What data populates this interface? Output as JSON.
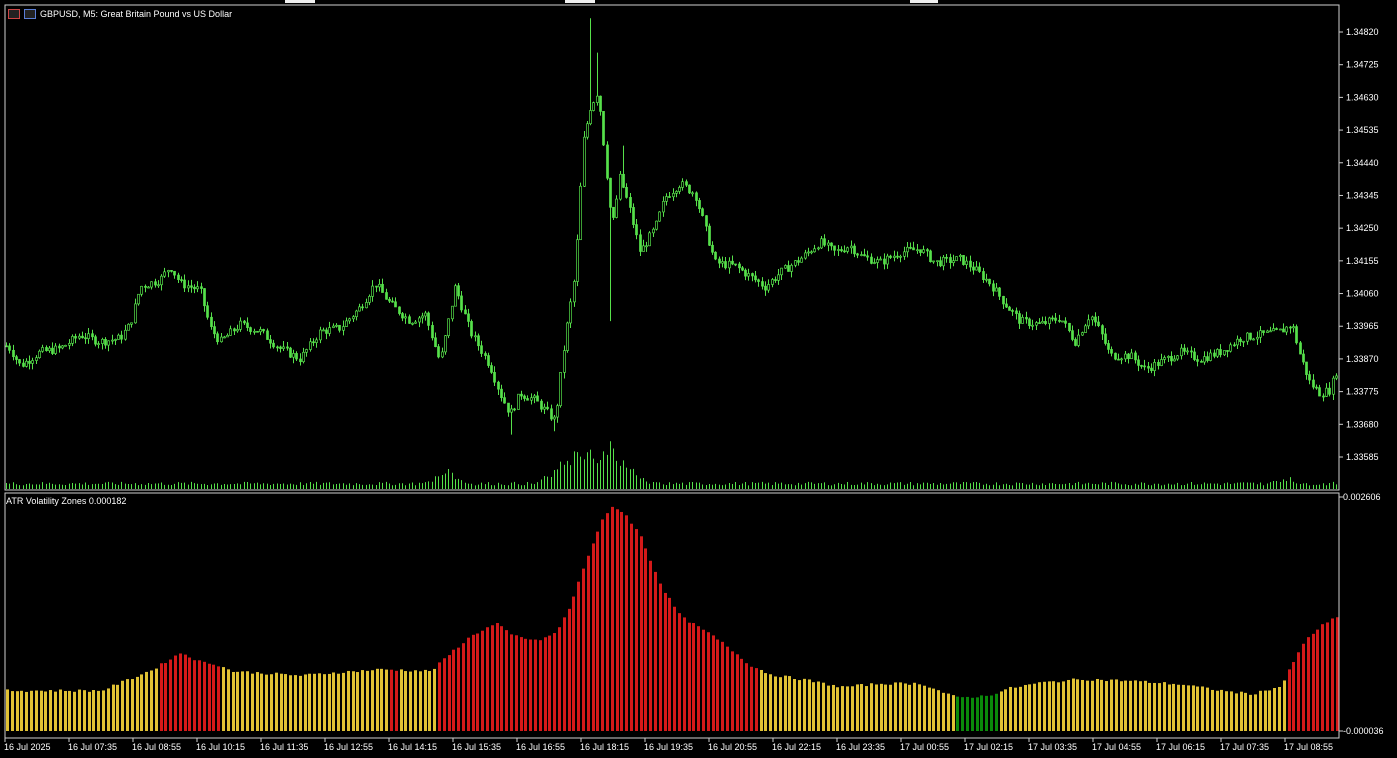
{
  "window": {
    "title": "GBPUSD, M5:  Great Britain Pound vs US Dollar"
  },
  "indicator": {
    "title": "ATR Volatility Zones 0.000182"
  },
  "icons": [
    "chart-window-icon",
    "chart-window-icon-2"
  ],
  "chart_data": [
    {
      "type": "candlestick",
      "title": "GBPUSD, M5:  Great Britain Pound vs US Dollar",
      "color_up": "#56e04a",
      "color_down": "#56e04a",
      "ylim": [
        1.3354,
        1.3489
      ],
      "y_ticks": [
        "1.34820",
        "1.34725",
        "1.34630",
        "1.34535",
        "1.34440",
        "1.34345",
        "1.34250",
        "1.34155",
        "1.34060",
        "1.33965",
        "1.33870",
        "1.33775",
        "1.33680",
        "1.33585"
      ],
      "x_ticks": [
        "16 Jul 2025",
        "16 Jul 07:35",
        "16 Jul 08:55",
        "16 Jul 10:15",
        "16 Jul 11:35",
        "16 Jul 12:55",
        "16 Jul 14:15",
        "16 Jul 15:35",
        "16 Jul 16:55",
        "16 Jul 18:15",
        "16 Jul 19:35",
        "16 Jul 20:55",
        "16 Jul 22:15",
        "16 Jul 23:35",
        "17 Jul 00:55",
        "17 Jul 02:15",
        "17 Jul 03:35",
        "17 Jul 04:55",
        "17 Jul 06:15",
        "17 Jul 07:35",
        "17 Jul 08:55"
      ],
      "close_path": [
        [
          0,
          1.3392
        ],
        [
          10,
          1.339
        ],
        [
          20,
          1.3385
        ],
        [
          40,
          1.3389
        ],
        [
          60,
          1.339
        ],
        [
          80,
          1.3394
        ],
        [
          100,
          1.3392
        ],
        [
          120,
          1.3393
        ],
        [
          130,
          1.3397
        ],
        [
          140,
          1.3408
        ],
        [
          160,
          1.341
        ],
        [
          170,
          1.3414
        ],
        [
          180,
          1.3409
        ],
        [
          200,
          1.3407
        ],
        [
          210,
          1.3396
        ],
        [
          220,
          1.3392
        ],
        [
          240,
          1.3397
        ],
        [
          260,
          1.3395
        ],
        [
          280,
          1.339
        ],
        [
          300,
          1.3387
        ],
        [
          320,
          1.3395
        ],
        [
          340,
          1.3396
        ],
        [
          360,
          1.3402
        ],
        [
          375,
          1.3409
        ],
        [
          390,
          1.3403
        ],
        [
          410,
          1.3398
        ],
        [
          425,
          1.34
        ],
        [
          440,
          1.3386
        ],
        [
          455,
          1.3408
        ],
        [
          470,
          1.3395
        ],
        [
          490,
          1.3385
        ],
        [
          500,
          1.3377
        ],
        [
          510,
          1.3371
        ],
        [
          520,
          1.3377
        ],
        [
          535,
          1.3375
        ],
        [
          545,
          1.3372
        ],
        [
          555,
          1.3369
        ],
        [
          565,
          1.3393
        ],
        [
          575,
          1.3412
        ],
        [
          583,
          1.345
        ],
        [
          590,
          1.346
        ],
        [
          598,
          1.3465
        ],
        [
          604,
          1.3448
        ],
        [
          612,
          1.3425
        ],
        [
          620,
          1.344
        ],
        [
          630,
          1.343
        ],
        [
          640,
          1.3418
        ],
        [
          655,
          1.3425
        ],
        [
          665,
          1.3434
        ],
        [
          680,
          1.3438
        ],
        [
          695,
          1.3435
        ],
        [
          705,
          1.3425
        ],
        [
          715,
          1.3415
        ],
        [
          735,
          1.3414
        ],
        [
          750,
          1.3411
        ],
        [
          765,
          1.3408
        ],
        [
          780,
          1.3412
        ],
        [
          800,
          1.3416
        ],
        [
          820,
          1.3421
        ],
        [
          835,
          1.3418
        ],
        [
          850,
          1.342
        ],
        [
          860,
          1.3417
        ],
        [
          880,
          1.3415
        ],
        [
          900,
          1.3418
        ],
        [
          920,
          1.3419
        ],
        [
          935,
          1.3415
        ],
        [
          960,
          1.3416
        ],
        [
          975,
          1.3413
        ],
        [
          990,
          1.3409
        ],
        [
          1005,
          1.3403
        ],
        [
          1020,
          1.3398
        ],
        [
          1040,
          1.3397
        ],
        [
          1060,
          1.3399
        ],
        [
          1075,
          1.3392
        ],
        [
          1090,
          1.34
        ],
        [
          1100,
          1.3395
        ],
        [
          1110,
          1.3388
        ],
        [
          1130,
          1.3388
        ],
        [
          1145,
          1.3384
        ],
        [
          1160,
          1.3386
        ],
        [
          1180,
          1.3389
        ],
        [
          1200,
          1.3387
        ],
        [
          1220,
          1.3389
        ],
        [
          1240,
          1.3393
        ],
        [
          1260,
          1.3394
        ],
        [
          1280,
          1.3395
        ],
        [
          1292,
          1.3397
        ],
        [
          1300,
          1.3388
        ],
        [
          1310,
          1.338
        ],
        [
          1320,
          1.3377
        ],
        [
          1330,
          1.3378
        ],
        [
          1340,
          1.3387
        ]
      ],
      "spike_highs": [
        [
          590,
          1.3486
        ],
        [
          598,
          1.3476
        ],
        [
          612,
          1.343
        ],
        [
          622,
          1.3449
        ]
      ],
      "spike_lows": [
        [
          510,
          1.3365
        ],
        [
          555,
          1.3366
        ],
        [
          610,
          1.3398
        ]
      ]
    },
    {
      "type": "volume",
      "color": "#56e04a",
      "baseline_volume": 1,
      "spikes": [
        [
          446,
          3
        ],
        [
          560,
          4
        ],
        [
          575,
          6
        ],
        [
          590,
          7
        ],
        [
          610,
          8
        ],
        [
          625,
          4
        ],
        [
          1285,
          2
        ]
      ]
    },
    {
      "type": "bar",
      "title": "ATR Volatility Zones 0.000182",
      "y_ticks": [
        "0.002606",
        "-0.000036"
      ],
      "ylim": [
        -3.6e-05,
        0.002606
      ],
      "zone_colors": {
        "low": "#0a8a0a",
        "mid": "#e0c234",
        "high": "#d41919"
      },
      "atr_path": [
        [
          0,
          0.00042
        ],
        [
          100,
          0.00042
        ],
        [
          150,
          0.00065
        ],
        [
          180,
          0.00085
        ],
        [
          200,
          0.00074
        ],
        [
          215,
          0.00072
        ],
        [
          230,
          0.00064
        ],
        [
          300,
          0.00059
        ],
        [
          330,
          0.00062
        ],
        [
          380,
          0.00066
        ],
        [
          430,
          0.00064
        ],
        [
          450,
          0.00085
        ],
        [
          470,
          0.00104
        ],
        [
          495,
          0.00118
        ],
        [
          510,
          0.00105
        ],
        [
          535,
          0.00098
        ],
        [
          555,
          0.00107
        ],
        [
          570,
          0.0014
        ],
        [
          585,
          0.0019
        ],
        [
          600,
          0.00232
        ],
        [
          612,
          0.00251
        ],
        [
          625,
          0.0024
        ],
        [
          640,
          0.00215
        ],
        [
          660,
          0.0016
        ],
        [
          680,
          0.00125
        ],
        [
          700,
          0.00112
        ],
        [
          720,
          0.00097
        ],
        [
          750,
          0.0007
        ],
        [
          770,
          0.0006
        ],
        [
          800,
          0.00055
        ],
        [
          840,
          0.00046
        ],
        [
          880,
          0.0005
        ],
        [
          920,
          0.0005
        ],
        [
          955,
          0.00034
        ],
        [
          985,
          0.00036
        ],
        [
          1010,
          0.00045
        ],
        [
          1040,
          0.00051
        ],
        [
          1080,
          0.00055
        ],
        [
          1130,
          0.00053
        ],
        [
          1180,
          0.00049
        ],
        [
          1220,
          0.00042
        ],
        [
          1250,
          0.00038
        ],
        [
          1280,
          0.00047
        ],
        [
          1290,
          0.0007
        ],
        [
          1305,
          0.001
        ],
        [
          1320,
          0.00115
        ],
        [
          1337,
          0.00126
        ]
      ],
      "high_zone_ranges": [
        [
          155,
          220
        ],
        [
          388,
          396
        ],
        [
          437,
          755
        ],
        [
          1286,
          1340
        ]
      ],
      "low_zone_ranges": [
        [
          955,
          997
        ]
      ]
    }
  ]
}
